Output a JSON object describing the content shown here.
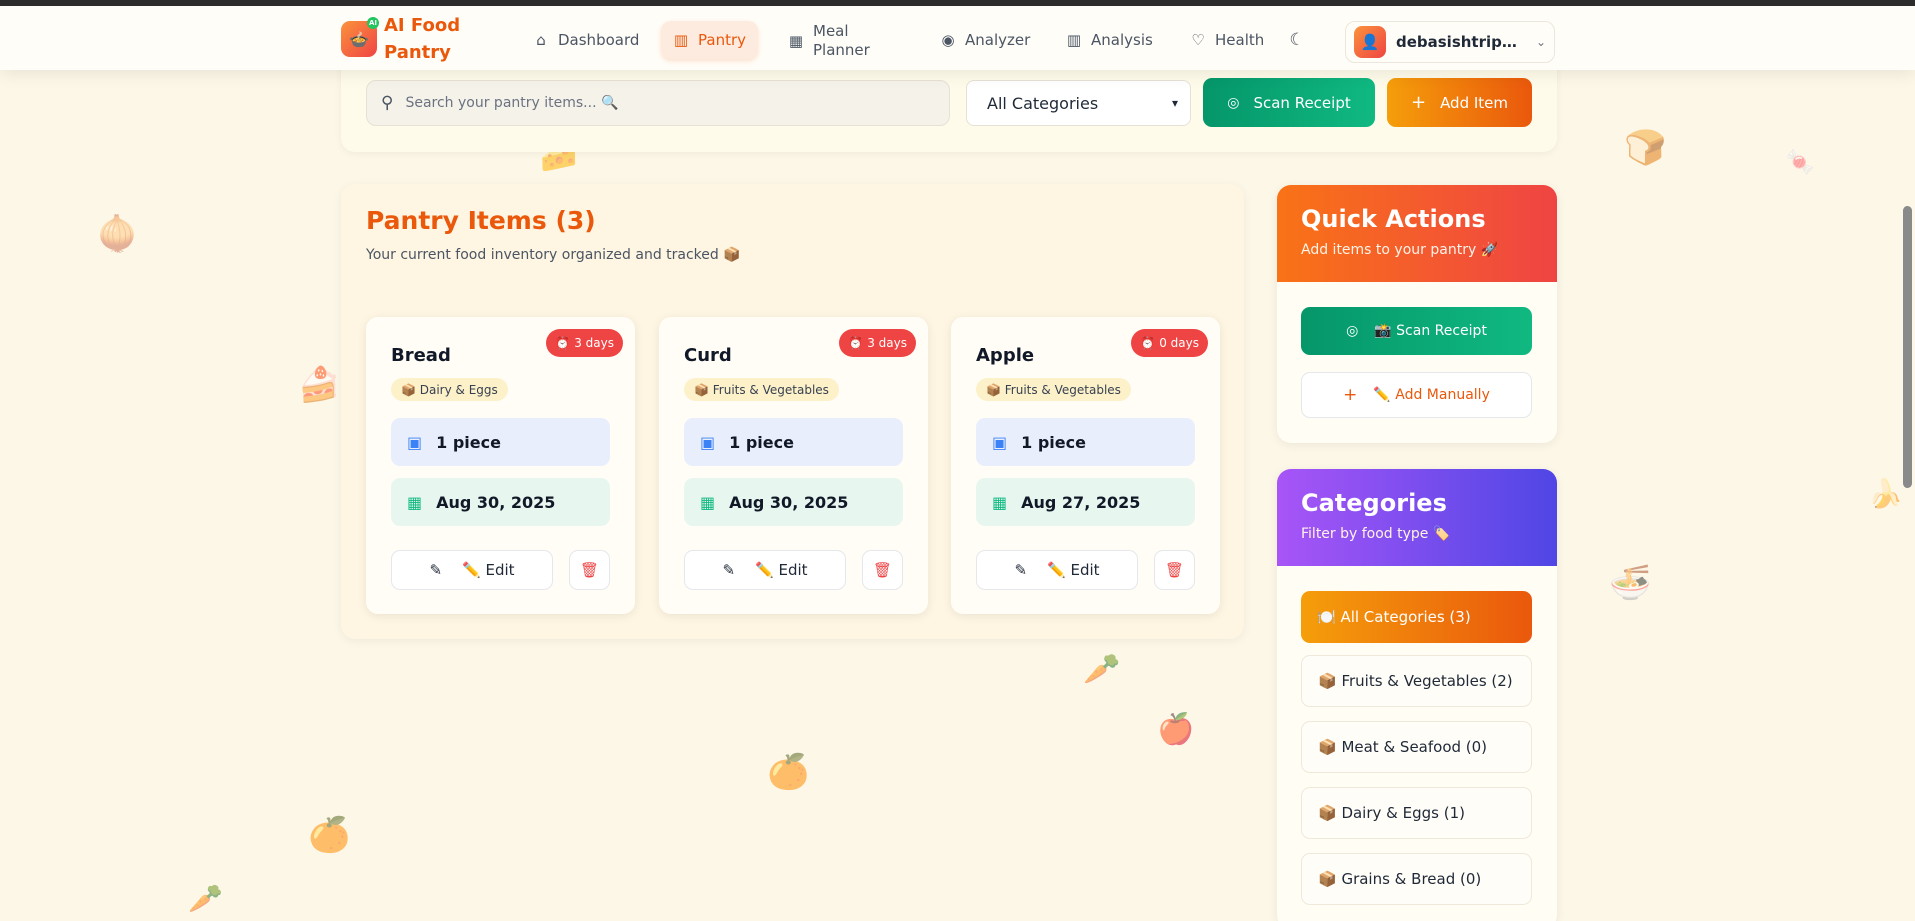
{
  "nav": {
    "logo_text": "AI Food Pantry",
    "logo_badge": "AI",
    "items": [
      {
        "label": "Dashboard",
        "icon": "home-icon"
      },
      {
        "label": "Pantry",
        "icon": "bar-chart-icon"
      },
      {
        "label": "Meal Planner",
        "icon": "calendar-icon"
      },
      {
        "label": "Analyzer",
        "icon": "camera-icon"
      },
      {
        "label": "Analysis",
        "icon": "bar-chart-icon"
      },
      {
        "label": "Health",
        "icon": "heart-icon"
      }
    ],
    "username": "debasishtripath..."
  },
  "toolbar": {
    "search_placeholder": "Search your pantry items... 🔍",
    "category_value": "All Categories",
    "scan_label": "Scan Receipt",
    "add_label": "Add Item"
  },
  "pantry": {
    "title": "Pantry Items (3)",
    "subtitle": "Your current food inventory organized and tracked 📦",
    "items": [
      {
        "name": "Bread",
        "days": "3 days",
        "category": "📦 Dairy & Eggs",
        "quantity": "1 piece",
        "date": "Aug 30, 2025",
        "edit_label": "✏️ Edit"
      },
      {
        "name": "Curd",
        "days": "3 days",
        "category": "📦 Fruits & Vegetables",
        "quantity": "1 piece",
        "date": "Aug 30, 2025",
        "edit_label": "✏️ Edit"
      },
      {
        "name": "Apple",
        "days": "0 days",
        "category": "📦 Fruits & Vegetables",
        "quantity": "1 piece",
        "date": "Aug 27, 2025",
        "edit_label": "✏️ Edit"
      }
    ]
  },
  "quick_actions": {
    "title": "Quick Actions",
    "subtitle": "Add items to your pantry 🚀",
    "scan_label": "📸 Scan Receipt",
    "manual_label": "✏️ Add Manually"
  },
  "categories": {
    "title": "Categories",
    "subtitle": "Filter by food type 🏷️",
    "items": [
      {
        "label": "🍽️ All Categories (3)"
      },
      {
        "label": "📦 Fruits & Vegetables (2)"
      },
      {
        "label": "📦 Meat & Seafood (0)"
      },
      {
        "label": "📦 Dairy & Eggs (1)"
      },
      {
        "label": "📦 Grains & Bread (0)"
      }
    ]
  },
  "colors": {
    "brand": "#ea580c",
    "scan_green": "#059669",
    "expiry_red": "#ef4444",
    "category_purple": "#a855f7"
  }
}
